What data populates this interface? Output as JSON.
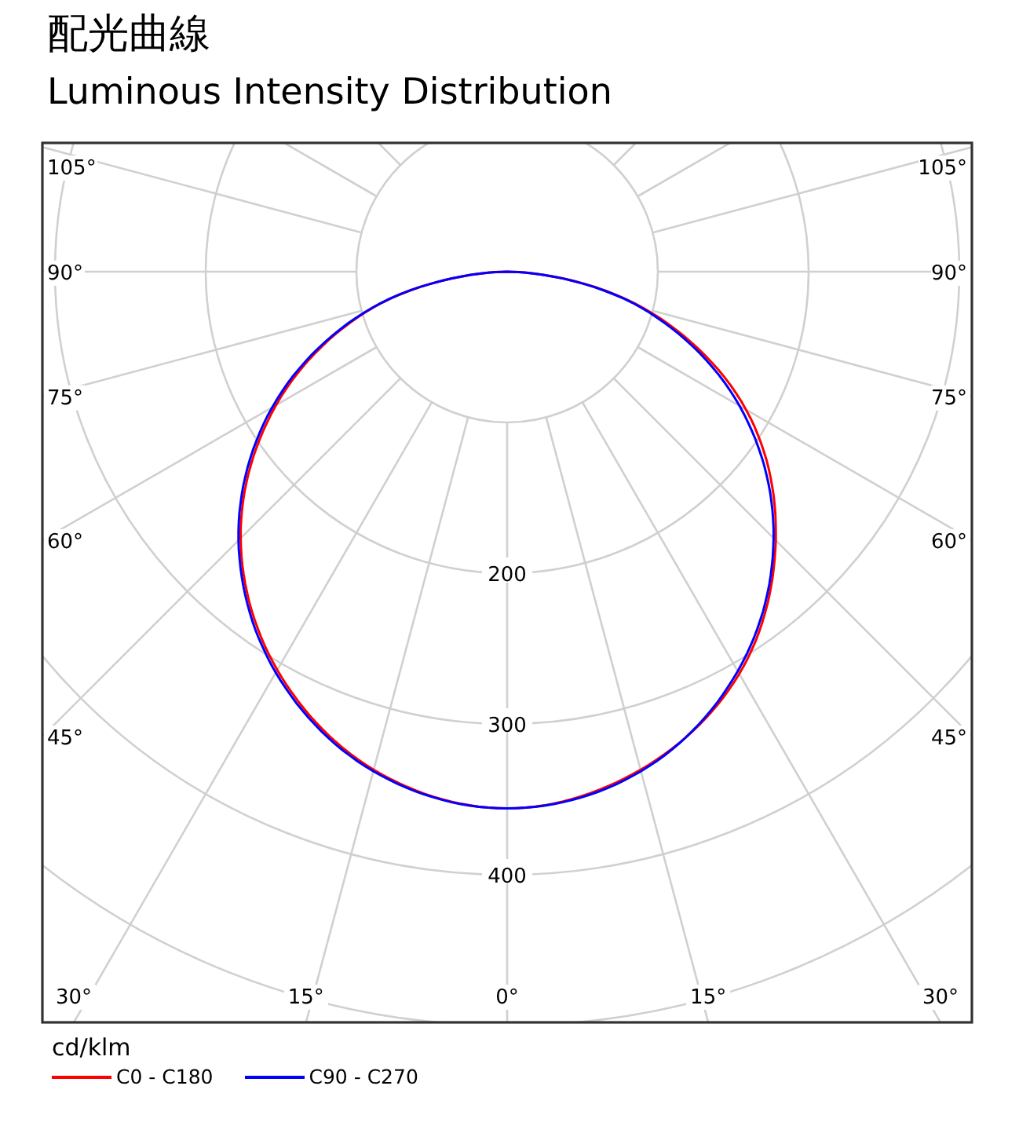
{
  "title": "配光曲線",
  "subtitle": "Luminous Intensity Distribution",
  "chart": {
    "left_labels": [
      "105°",
      "90°",
      "75°",
      "60°",
      "45°"
    ],
    "bottom_labels": [
      "30°",
      "15°",
      "0°",
      "15°",
      "30°"
    ],
    "right_labels": [
      "105°",
      "90°",
      "75°",
      "60°",
      "45°"
    ],
    "ring_labels": [
      "200",
      "300",
      "400"
    ],
    "unit": "cd/klm",
    "series": [
      {
        "name": "C0 - C180",
        "color": "#ff0000"
      },
      {
        "name": "C90 - C270",
        "color": "#0000ff"
      }
    ]
  }
}
